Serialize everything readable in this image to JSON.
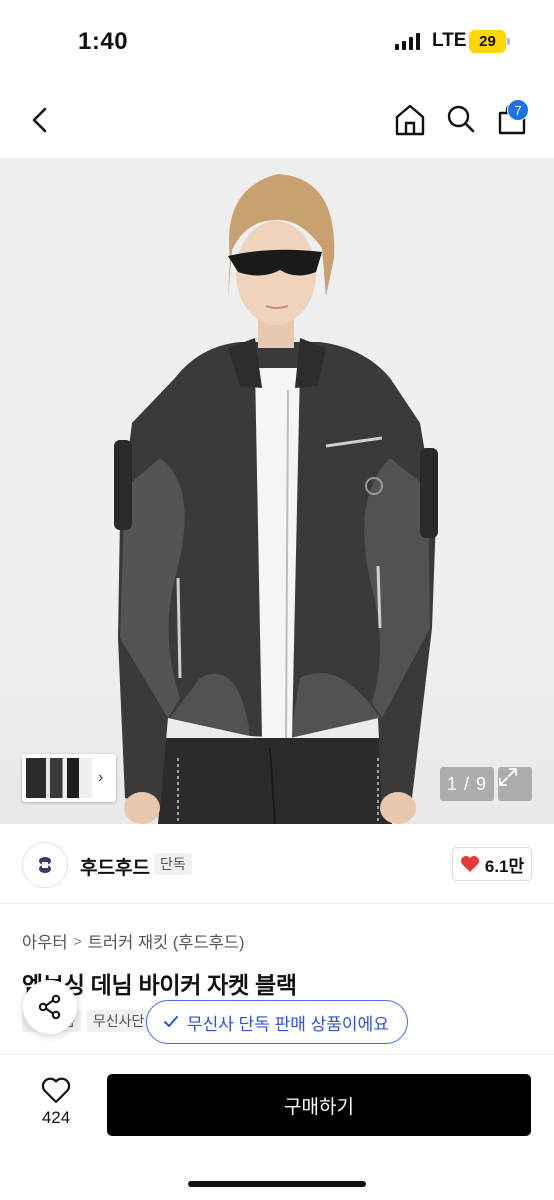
{
  "status_bar": {
    "time": "1:40",
    "network": "LTE",
    "battery": "29",
    "battery_color": "#ffd60a"
  },
  "nav": {
    "back_icon": "chevron-left-icon",
    "home_icon": "home-icon",
    "search_icon": "search-icon",
    "cart_icon": "shopping-bag-icon",
    "cart_count": "7",
    "badge_color": "#1a73e8"
  },
  "gallery": {
    "counter": "1 / 9",
    "expand_icon": "expand-icon",
    "thumb_arrow": "›"
  },
  "brand": {
    "name": "후드후드",
    "exclusive_label": "단독",
    "likes": "6.1만",
    "like_color": "#e53935"
  },
  "product": {
    "breadcrumb": [
      "아우터",
      "트러커 재킷 (후드후드)"
    ],
    "breadcrumb_sep": ">",
    "title": "엠보싱 데님 바이커 자켓 블랙",
    "tags": [
      "품",
      "무신사단"
    ]
  },
  "toast": {
    "text": "무신사 단독 판매 상품이에요",
    "accent": "#2f54c9"
  },
  "bottom_bar": {
    "wish_count": "424",
    "buy_label": "구매하기"
  }
}
